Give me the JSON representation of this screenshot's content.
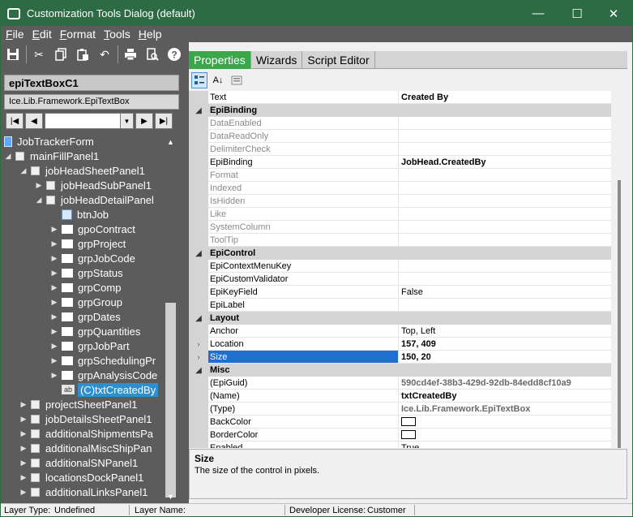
{
  "window": {
    "title": "Customization Tools Dialog (default)",
    "minimize": "—",
    "maximize": "☐",
    "close": "✕"
  },
  "menu": [
    "File",
    "Edit",
    "Format",
    "Tools",
    "Help"
  ],
  "control": {
    "name": "epiTextBoxC1",
    "type": "Ice.Lib.Framework.EpiTextBox"
  },
  "tree": [
    {
      "label": "JobTrackerForm",
      "indent": 0,
      "icon": "form",
      "twisty": ""
    },
    {
      "label": "mainFillPanel1",
      "indent": 0,
      "icon": "square",
      "twisty": "◢"
    },
    {
      "label": "jobHeadSheetPanel1",
      "indent": 1,
      "icon": "square",
      "twisty": "◢"
    },
    {
      "label": "jobHeadSubPanel1",
      "indent": 2,
      "icon": "square",
      "twisty": "▶"
    },
    {
      "label": "jobHeadDetailPanel",
      "indent": 2,
      "icon": "square",
      "twisty": "◢"
    },
    {
      "label": "btnJob",
      "indent": 3,
      "icon": "button",
      "twisty": ""
    },
    {
      "label": "gpoContract",
      "indent": 3,
      "icon": "folder",
      "twisty": "▶"
    },
    {
      "label": "grpProject",
      "indent": 3,
      "icon": "folder",
      "twisty": "▶"
    },
    {
      "label": "grpJobCode",
      "indent": 3,
      "icon": "folder",
      "twisty": "▶"
    },
    {
      "label": "grpStatus",
      "indent": 3,
      "icon": "folder",
      "twisty": "▶"
    },
    {
      "label": "grpComp",
      "indent": 3,
      "icon": "folder",
      "twisty": "▶"
    },
    {
      "label": "grpGroup",
      "indent": 3,
      "icon": "folder",
      "twisty": "▶"
    },
    {
      "label": "grpDates",
      "indent": 3,
      "icon": "folder",
      "twisty": "▶"
    },
    {
      "label": "grpQuantities",
      "indent": 3,
      "icon": "folder",
      "twisty": "▶"
    },
    {
      "label": "grpJobPart",
      "indent": 3,
      "icon": "folder",
      "twisty": "▶"
    },
    {
      "label": "grpSchedulingPr",
      "indent": 3,
      "icon": "folder",
      "twisty": "▶"
    },
    {
      "label": "grpAnalysisCode",
      "indent": 3,
      "icon": "folder",
      "twisty": "▶"
    },
    {
      "label": "(C)txtCreatedBy",
      "indent": 3,
      "icon": "textbox",
      "twisty": "",
      "selected": true
    },
    {
      "label": "projectSheetPanel1",
      "indent": 1,
      "icon": "square",
      "twisty": "▶"
    },
    {
      "label": "jobDetailsSheetPanel1",
      "indent": 1,
      "icon": "square",
      "twisty": "▶"
    },
    {
      "label": "additionalShipmentsPa",
      "indent": 1,
      "icon": "square",
      "twisty": "▶"
    },
    {
      "label": "additionalMiscShipPan",
      "indent": 1,
      "icon": "square",
      "twisty": "▶"
    },
    {
      "label": "additionalSNPanel1",
      "indent": 1,
      "icon": "square",
      "twisty": "▶"
    },
    {
      "label": "locationsDockPanel1",
      "indent": 1,
      "icon": "square",
      "twisty": "▶"
    },
    {
      "label": "additionalLinksPanel1",
      "indent": 1,
      "icon": "square",
      "twisty": "▶"
    }
  ],
  "tabs": [
    {
      "label": "Properties",
      "active": true
    },
    {
      "label": "Wizards",
      "active": false
    },
    {
      "label": "Script Editor",
      "active": false
    }
  ],
  "properties": [
    {
      "kind": "prop",
      "name": "Text",
      "value": "Created By",
      "bold": true
    },
    {
      "kind": "cat",
      "name": "EpiBinding"
    },
    {
      "kind": "prop",
      "name": "DataEnabled",
      "value": "",
      "disabled": true
    },
    {
      "kind": "prop",
      "name": "DataReadOnly",
      "value": "",
      "disabled": true
    },
    {
      "kind": "prop",
      "name": "DelimiterCheck",
      "value": "",
      "disabled": true
    },
    {
      "kind": "prop",
      "name": "EpiBinding",
      "value": "JobHead.CreatedBy",
      "bold": true
    },
    {
      "kind": "prop",
      "name": "Format",
      "value": "",
      "disabled": true
    },
    {
      "kind": "prop",
      "name": "Indexed",
      "value": "",
      "disabled": true
    },
    {
      "kind": "prop",
      "name": "IsHidden",
      "value": "",
      "disabled": true
    },
    {
      "kind": "prop",
      "name": "Like",
      "value": "",
      "disabled": true
    },
    {
      "kind": "prop",
      "name": "SystemColumn",
      "value": "",
      "disabled": true
    },
    {
      "kind": "prop",
      "name": "ToolTip",
      "value": "",
      "disabled": true
    },
    {
      "kind": "cat",
      "name": "EpiControl"
    },
    {
      "kind": "prop",
      "name": "EpiContextMenuKey",
      "value": ""
    },
    {
      "kind": "prop",
      "name": "EpiCustomValidator",
      "value": ""
    },
    {
      "kind": "prop",
      "name": "EpiKeyField",
      "value": "False"
    },
    {
      "kind": "prop",
      "name": "EpiLabel",
      "value": ""
    },
    {
      "kind": "cat",
      "name": "Layout"
    },
    {
      "kind": "prop",
      "name": "Anchor",
      "value": "Top, Left"
    },
    {
      "kind": "prop",
      "name": "Location",
      "value": "157, 409",
      "bold": true,
      "expand": true
    },
    {
      "kind": "prop",
      "name": "Size",
      "value": "150, 20",
      "bold": true,
      "expand": true,
      "selected": true
    },
    {
      "kind": "cat",
      "name": "Misc"
    },
    {
      "kind": "prop",
      "name": "(EpiGuid)",
      "value": "590cd4ef-38b3-429d-92db-84edd8cf10a9",
      "bold": true,
      "dimval": true
    },
    {
      "kind": "prop",
      "name": "(Name)",
      "value": "txtCreatedBy",
      "bold": true
    },
    {
      "kind": "prop",
      "name": "(Type)",
      "value": "Ice.Lib.Framework.EpiTextBox",
      "bold": true,
      "dimval": true
    },
    {
      "kind": "prop",
      "name": "BackColor",
      "value": "",
      "swatch": true
    },
    {
      "kind": "prop",
      "name": "BorderColor",
      "value": "",
      "swatch": true
    },
    {
      "kind": "prop",
      "name": "Enabled",
      "value": "True"
    }
  ],
  "description": {
    "title": "Size",
    "text": "The size of the control in pixels."
  },
  "status": {
    "layer_type_label": "Layer Type:",
    "layer_type": "Undefined",
    "layer_name_label": "Layer Name:",
    "layer_name": "",
    "license_label": "Developer License:",
    "license": "Customer"
  },
  "colors": {
    "titlebar": "#2d6b45",
    "panel": "#5c5c5c",
    "active_tab": "#3aa74a",
    "selection": "#1f6fd0"
  }
}
